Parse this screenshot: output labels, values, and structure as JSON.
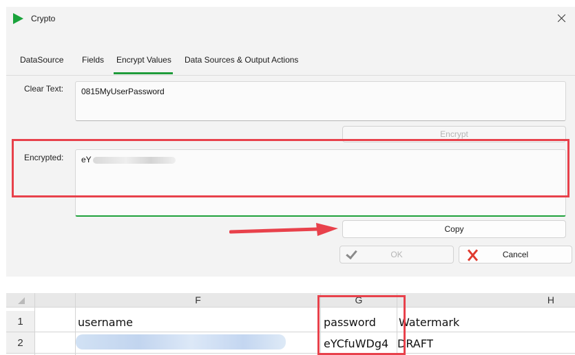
{
  "window": {
    "title": "Crypto",
    "app_icon": "play-triangle-icon",
    "close_icon": "close-icon"
  },
  "tabs": [
    {
      "label": "DataSource",
      "active": false
    },
    {
      "label": "Fields",
      "active": false
    },
    {
      "label": "Encrypt Values",
      "active": true
    },
    {
      "label": "Data Sources & Output Actions",
      "active": false
    }
  ],
  "form": {
    "clear_text_label": "Clear Text:",
    "clear_text_value": "0815MyUserPassword",
    "encrypt_button": "Encrypt",
    "encrypted_label": "Encrypted:",
    "encrypted_value_visible": "eY",
    "copy_button": "Copy",
    "ok_button": "OK",
    "cancel_button": "Cancel"
  },
  "colors": {
    "accent": "#1e9b3a",
    "annotation": "#e8414b",
    "cancel_icon": "#e03a2e"
  },
  "spreadsheet": {
    "columns": [
      "F",
      "G",
      "H"
    ],
    "rows": [
      {
        "row": "1",
        "F": "username",
        "G": "password",
        "H": "Watermark"
      },
      {
        "row": "2",
        "F": "",
        "G": "eYCfuWDg4",
        "H": "DRAFT"
      }
    ]
  }
}
